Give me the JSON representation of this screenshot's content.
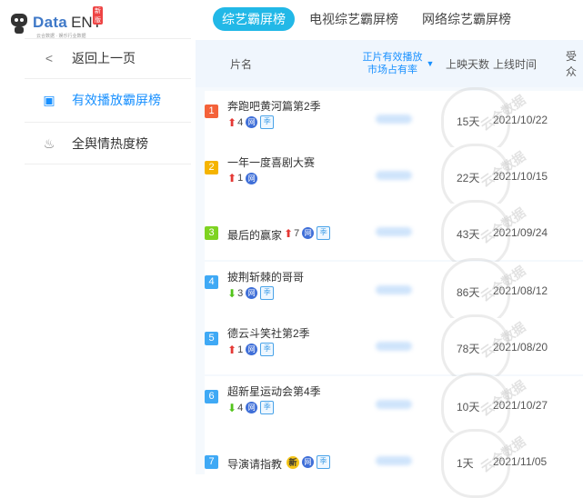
{
  "logo": {
    "brand": "Data",
    "suffix": "ENT",
    "badge": "新版",
    "tagline": "云合数据 · 娱乐行业数据"
  },
  "sidebar": {
    "items": [
      {
        "label": "返回上一页",
        "icon": "back-arrow-icon",
        "glyph": "<"
      },
      {
        "label": "有效播放霸屏榜",
        "icon": "tv-icon",
        "glyph": "▣",
        "active": true
      },
      {
        "label": "全舆情热度榜",
        "icon": "flame-icon",
        "glyph": "♨"
      }
    ]
  },
  "tabs": [
    {
      "label": "综艺霸屏榜",
      "active": true
    },
    {
      "label": "电视综艺霸屏榜"
    },
    {
      "label": "网络综艺霸屏榜"
    }
  ],
  "table": {
    "headers": {
      "name": "片名",
      "share_line1": "正片有效播放",
      "share_line2": "市场占有率",
      "days": "上映天数",
      "date": "上线时间",
      "more": "受众"
    },
    "rows": [
      {
        "rank": "1",
        "rank_color": "#f4623a",
        "title": "奔跑吧黄河篇第2季",
        "trend": "up",
        "change": "4",
        "tags": [
          "网",
          "季"
        ],
        "days": "15天",
        "date": "2021/10/22"
      },
      {
        "rank": "2",
        "rank_color": "#f5b400",
        "title": "一年一度喜剧大赛",
        "trend": "up",
        "change": "1",
        "tags": [
          "网"
        ],
        "days": "22天",
        "date": "2021/10/15"
      },
      {
        "rank": "3",
        "rank_color": "#7ed321",
        "title": "最后的赢家",
        "trend": "up",
        "change": "7",
        "tags": [
          "网",
          "季"
        ],
        "days": "43天",
        "date": "2021/09/24",
        "inline": true
      },
      {
        "rank": "4",
        "rank_color": "#3fa9f5",
        "title": "披荆斩棘的哥哥",
        "trend": "down",
        "change": "3",
        "tags": [
          "网",
          "季"
        ],
        "days": "86天",
        "date": "2021/08/12"
      },
      {
        "rank": "5",
        "rank_color": "#3fa9f5",
        "title": "德云斗笑社第2季",
        "trend": "up",
        "change": "1",
        "tags": [
          "网",
          "季"
        ],
        "days": "78天",
        "date": "2021/08/20"
      },
      {
        "rank": "6",
        "rank_color": "#3fa9f5",
        "title": "超新星运动会第4季",
        "trend": "down",
        "change": "4",
        "tags": [
          "网",
          "季"
        ],
        "days": "10天",
        "date": "2021/10/27"
      },
      {
        "rank": "7",
        "rank_color": "#3fa9f5",
        "title": "导演请指教",
        "trend": "new",
        "change": "新",
        "tags": [
          "网",
          "季"
        ],
        "days": "1天",
        "date": "2021/11/05",
        "inline": true
      }
    ]
  },
  "watermark": {
    "text": "云合数据",
    "sub": "ENLIGHTENT"
  }
}
